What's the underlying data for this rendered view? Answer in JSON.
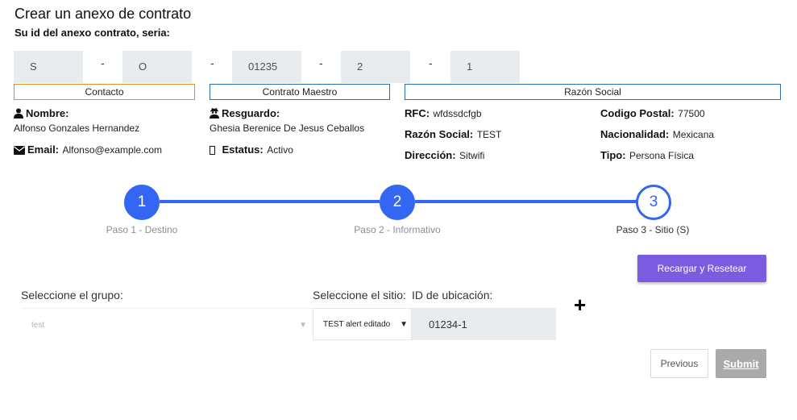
{
  "header": {
    "title": "Crear un anexo de contrato",
    "subtitle": "Su id del anexo contrato, seria:"
  },
  "id_parts": [
    "S",
    "O",
    "01235",
    "2",
    "1"
  ],
  "id_separator": "-",
  "sections": {
    "contacto": "Contacto",
    "contrato_maestro": "Contrato Maestro",
    "razon_social": "Razón Social"
  },
  "contacto": {
    "nombre_label": "Nombre:",
    "nombre_value": "Alfonso Gonzales Hernandez",
    "email_label": "Email:",
    "email_value": "Alfonso@example.com"
  },
  "contrato": {
    "resguardo_label": "Resguardo:",
    "resguardo_value": "Ghesia Berenice De Jesus Ceballos",
    "estatus_label": "Estatus:",
    "estatus_value": "Activo"
  },
  "razon": {
    "rfc_label": "RFC:",
    "rfc_value": "wfdssdcfgb",
    "razon_label": "Razón Social:",
    "razon_value": "TEST",
    "direccion_label": "Dirección:",
    "direccion_value": "Sitwifi",
    "cp_label": "Codigo Postal:",
    "cp_value": "77500",
    "nacionalidad_label": "Nacionalidad:",
    "nacionalidad_value": "Mexicana",
    "tipo_label": "Tipo:",
    "tipo_value": "Persona Física"
  },
  "stepper": {
    "steps": [
      {
        "number": "1",
        "label": "Paso 1 - Destino",
        "state": "done"
      },
      {
        "number": "2",
        "label": "Paso 2 - Informativo",
        "state": "done"
      },
      {
        "number": "3",
        "label": "Paso 3 - Sitio (S)",
        "state": "current"
      }
    ],
    "accent_color": "#3366f3"
  },
  "actions": {
    "reload_label": "Recargar y Resetear",
    "previous_label": "Previous",
    "submit_label": "Submit"
  },
  "form": {
    "grupo_label": "Seleccione el grupo:",
    "grupo_value": "test",
    "sitio_label": "Seleccione el sitio:",
    "sitio_value": "TEST alert editado",
    "ubicacion_label": "ID de ubicación:",
    "ubicacion_value": "01234-1",
    "add_symbol": "+"
  },
  "icons": {
    "nombre": "user-icon",
    "email": "envelope-icon",
    "resguardo": "user-secret-icon",
    "estatus": "status-icon"
  }
}
